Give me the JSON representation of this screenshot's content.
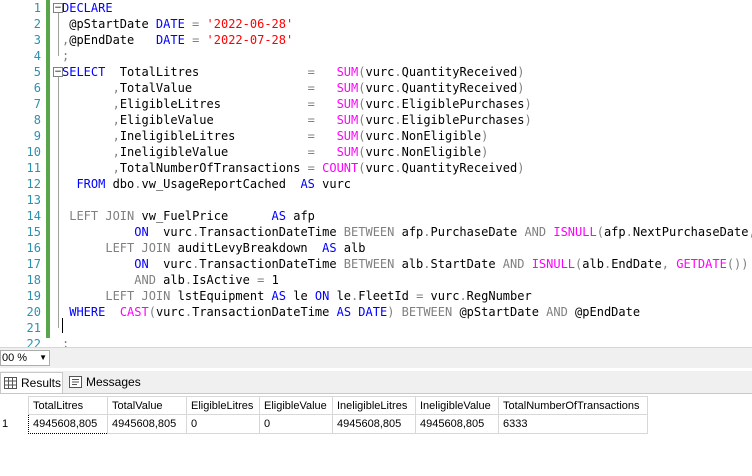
{
  "editor": {
    "lines": [
      {
        "n": "1",
        "tokens": [
          {
            "t": "DECLARE",
            "c": "kw"
          }
        ]
      },
      {
        "n": "2",
        "tokens": [
          {
            "t": " @pStartDate ",
            "c": "var"
          },
          {
            "t": "DATE",
            "c": "kw"
          },
          {
            "t": " = ",
            "c": "op"
          },
          {
            "t": "'2022-06-28'",
            "c": "str"
          }
        ]
      },
      {
        "n": "3",
        "tokens": [
          {
            "t": ",",
            "c": "op"
          },
          {
            "t": "@pEndDate   ",
            "c": "var"
          },
          {
            "t": "DATE",
            "c": "kw"
          },
          {
            "t": " = ",
            "c": "op"
          },
          {
            "t": "'2022-07-28'",
            "c": "str"
          }
        ]
      },
      {
        "n": "4",
        "tokens": [
          {
            "t": ";",
            "c": "op"
          }
        ]
      },
      {
        "n": "5",
        "tokens": [
          {
            "t": "SELECT",
            "c": "kw"
          },
          {
            "t": "  TotalLitres               ",
            "c": "var"
          },
          {
            "t": "=",
            "c": "op"
          },
          {
            "t": "   ",
            "c": "var"
          },
          {
            "t": "SUM",
            "c": "fn"
          },
          {
            "t": "(",
            "c": "op"
          },
          {
            "t": "vurc",
            "c": "var"
          },
          {
            "t": ".",
            "c": "op"
          },
          {
            "t": "QuantityReceived",
            "c": "var"
          },
          {
            "t": ")",
            "c": "op"
          }
        ]
      },
      {
        "n": "6",
        "tokens": [
          {
            "t": "       ",
            "c": "var"
          },
          {
            "t": ",",
            "c": "op"
          },
          {
            "t": "TotalValue                ",
            "c": "var"
          },
          {
            "t": "=",
            "c": "op"
          },
          {
            "t": "   ",
            "c": "var"
          },
          {
            "t": "SUM",
            "c": "fn"
          },
          {
            "t": "(",
            "c": "op"
          },
          {
            "t": "vurc",
            "c": "var"
          },
          {
            "t": ".",
            "c": "op"
          },
          {
            "t": "QuantityReceived",
            "c": "var"
          },
          {
            "t": ")",
            "c": "op"
          }
        ]
      },
      {
        "n": "7",
        "tokens": [
          {
            "t": "       ",
            "c": "var"
          },
          {
            "t": ",",
            "c": "op"
          },
          {
            "t": "EligibleLitres            ",
            "c": "var"
          },
          {
            "t": "=",
            "c": "op"
          },
          {
            "t": "   ",
            "c": "var"
          },
          {
            "t": "SUM",
            "c": "fn"
          },
          {
            "t": "(",
            "c": "op"
          },
          {
            "t": "vurc",
            "c": "var"
          },
          {
            "t": ".",
            "c": "op"
          },
          {
            "t": "EligiblePurchases",
            "c": "var"
          },
          {
            "t": ")",
            "c": "op"
          }
        ]
      },
      {
        "n": "8",
        "tokens": [
          {
            "t": "       ",
            "c": "var"
          },
          {
            "t": ",",
            "c": "op"
          },
          {
            "t": "EligibleValue             ",
            "c": "var"
          },
          {
            "t": "=",
            "c": "op"
          },
          {
            "t": "   ",
            "c": "var"
          },
          {
            "t": "SUM",
            "c": "fn"
          },
          {
            "t": "(",
            "c": "op"
          },
          {
            "t": "vurc",
            "c": "var"
          },
          {
            "t": ".",
            "c": "op"
          },
          {
            "t": "EligiblePurchases",
            "c": "var"
          },
          {
            "t": ")",
            "c": "op"
          }
        ]
      },
      {
        "n": "9",
        "tokens": [
          {
            "t": "       ",
            "c": "var"
          },
          {
            "t": ",",
            "c": "op"
          },
          {
            "t": "IneligibleLitres          ",
            "c": "var"
          },
          {
            "t": "=",
            "c": "op"
          },
          {
            "t": "   ",
            "c": "var"
          },
          {
            "t": "SUM",
            "c": "fn"
          },
          {
            "t": "(",
            "c": "op"
          },
          {
            "t": "vurc",
            "c": "var"
          },
          {
            "t": ".",
            "c": "op"
          },
          {
            "t": "NonEligible",
            "c": "var"
          },
          {
            "t": ")",
            "c": "op"
          }
        ]
      },
      {
        "n": "10",
        "tokens": [
          {
            "t": "       ",
            "c": "var"
          },
          {
            "t": ",",
            "c": "op"
          },
          {
            "t": "IneligibleValue           ",
            "c": "var"
          },
          {
            "t": "=",
            "c": "op"
          },
          {
            "t": "   ",
            "c": "var"
          },
          {
            "t": "SUM",
            "c": "fn"
          },
          {
            "t": "(",
            "c": "op"
          },
          {
            "t": "vurc",
            "c": "var"
          },
          {
            "t": ".",
            "c": "op"
          },
          {
            "t": "NonEligible",
            "c": "var"
          },
          {
            "t": ")",
            "c": "op"
          }
        ]
      },
      {
        "n": "11",
        "tokens": [
          {
            "t": "       ",
            "c": "var"
          },
          {
            "t": ",",
            "c": "op"
          },
          {
            "t": "TotalNumberOfTransactions ",
            "c": "var"
          },
          {
            "t": "=",
            "c": "op"
          },
          {
            "t": " ",
            "c": "var"
          },
          {
            "t": "COUNT",
            "c": "fn"
          },
          {
            "t": "(",
            "c": "op"
          },
          {
            "t": "vurc",
            "c": "var"
          },
          {
            "t": ".",
            "c": "op"
          },
          {
            "t": "QuantityReceived",
            "c": "var"
          },
          {
            "t": ")",
            "c": "op"
          }
        ]
      },
      {
        "n": "12",
        "tokens": [
          {
            "t": "  ",
            "c": "var"
          },
          {
            "t": "FROM",
            "c": "kw"
          },
          {
            "t": " dbo",
            "c": "var"
          },
          {
            "t": ".",
            "c": "op"
          },
          {
            "t": "vw_UsageReportCached  ",
            "c": "var"
          },
          {
            "t": "AS",
            "c": "kw"
          },
          {
            "t": " vurc",
            "c": "var"
          }
        ]
      },
      {
        "n": "13",
        "tokens": []
      },
      {
        "n": "14",
        "tokens": [
          {
            "t": " ",
            "c": "var"
          },
          {
            "t": "LEFT JOIN",
            "c": "op"
          },
          {
            "t": " vw_FuelPrice      ",
            "c": "var"
          },
          {
            "t": "AS",
            "c": "kw"
          },
          {
            "t": " afp",
            "c": "var"
          }
        ]
      },
      {
        "n": "15",
        "tokens": [
          {
            "t": "          ",
            "c": "var"
          },
          {
            "t": "ON",
            "c": "kw"
          },
          {
            "t": "  vurc",
            "c": "var"
          },
          {
            "t": ".",
            "c": "op"
          },
          {
            "t": "TransactionDateTime ",
            "c": "var"
          },
          {
            "t": "BETWEEN",
            "c": "op"
          },
          {
            "t": " afp",
            "c": "var"
          },
          {
            "t": ".",
            "c": "op"
          },
          {
            "t": "PurchaseDate ",
            "c": "var"
          },
          {
            "t": "AND",
            "c": "op"
          },
          {
            "t": " ",
            "c": "var"
          },
          {
            "t": "ISNULL",
            "c": "fn"
          },
          {
            "t": "(",
            "c": "op"
          },
          {
            "t": "afp",
            "c": "var"
          },
          {
            "t": ".",
            "c": "op"
          },
          {
            "t": "NextPurchaseDate",
            "c": "var"
          },
          {
            "t": ",",
            "c": "op"
          }
        ]
      },
      {
        "n": "16",
        "tokens": [
          {
            "t": "      ",
            "c": "var"
          },
          {
            "t": "LEFT JOIN",
            "c": "op"
          },
          {
            "t": " auditLevyBreakdown  ",
            "c": "var"
          },
          {
            "t": "AS",
            "c": "kw"
          },
          {
            "t": " alb",
            "c": "var"
          }
        ]
      },
      {
        "n": "17",
        "tokens": [
          {
            "t": "          ",
            "c": "var"
          },
          {
            "t": "ON",
            "c": "kw"
          },
          {
            "t": "  vurc",
            "c": "var"
          },
          {
            "t": ".",
            "c": "op"
          },
          {
            "t": "TransactionDateTime ",
            "c": "var"
          },
          {
            "t": "BETWEEN",
            "c": "op"
          },
          {
            "t": " alb",
            "c": "var"
          },
          {
            "t": ".",
            "c": "op"
          },
          {
            "t": "StartDate ",
            "c": "var"
          },
          {
            "t": "AND",
            "c": "op"
          },
          {
            "t": " ",
            "c": "var"
          },
          {
            "t": "ISNULL",
            "c": "fn"
          },
          {
            "t": "(",
            "c": "op"
          },
          {
            "t": "alb",
            "c": "var"
          },
          {
            "t": ".",
            "c": "op"
          },
          {
            "t": "EndDate",
            "c": "var"
          },
          {
            "t": ", ",
            "c": "op"
          },
          {
            "t": "GETDATE",
            "c": "fn"
          },
          {
            "t": "())",
            "c": "op"
          }
        ]
      },
      {
        "n": "18",
        "tokens": [
          {
            "t": "          ",
            "c": "var"
          },
          {
            "t": "AND",
            "c": "op"
          },
          {
            "t": " alb",
            "c": "var"
          },
          {
            "t": ".",
            "c": "op"
          },
          {
            "t": "IsActive ",
            "c": "var"
          },
          {
            "t": "=",
            "c": "op"
          },
          {
            "t": " 1",
            "c": "var"
          }
        ]
      },
      {
        "n": "19",
        "tokens": [
          {
            "t": "      ",
            "c": "var"
          },
          {
            "t": "LEFT JOIN",
            "c": "op"
          },
          {
            "t": " lstEquipment ",
            "c": "var"
          },
          {
            "t": "AS",
            "c": "kw"
          },
          {
            "t": " le ",
            "c": "var"
          },
          {
            "t": "ON",
            "c": "kw"
          },
          {
            "t": " le",
            "c": "var"
          },
          {
            "t": ".",
            "c": "op"
          },
          {
            "t": "FleetId ",
            "c": "var"
          },
          {
            "t": "=",
            "c": "op"
          },
          {
            "t": " vurc",
            "c": "var"
          },
          {
            "t": ".",
            "c": "op"
          },
          {
            "t": "RegNumber",
            "c": "var"
          }
        ]
      },
      {
        "n": "20",
        "tokens": [
          {
            "t": " ",
            "c": "var"
          },
          {
            "t": "WHERE",
            "c": "kw"
          },
          {
            "t": "  ",
            "c": "var"
          },
          {
            "t": "CAST",
            "c": "fn"
          },
          {
            "t": "(",
            "c": "op"
          },
          {
            "t": "vurc",
            "c": "var"
          },
          {
            "t": ".",
            "c": "op"
          },
          {
            "t": "TransactionDateTime ",
            "c": "var"
          },
          {
            "t": "AS",
            "c": "kw"
          },
          {
            "t": " ",
            "c": "var"
          },
          {
            "t": "DATE",
            "c": "kw"
          },
          {
            "t": ") ",
            "c": "op"
          },
          {
            "t": "BETWEEN",
            "c": "op"
          },
          {
            "t": " @pStartDate ",
            "c": "var"
          },
          {
            "t": "AND",
            "c": "op"
          },
          {
            "t": " @pEndDate",
            "c": "var"
          }
        ]
      },
      {
        "n": "21",
        "tokens": []
      },
      {
        "n": "22",
        "tokens": [
          {
            "t": ";",
            "c": "op"
          }
        ]
      }
    ]
  },
  "statusbar": {
    "zoom": "00 %"
  },
  "tabs": [
    {
      "label": "Results",
      "icon": "grid-icon",
      "active": true
    },
    {
      "label": "Messages",
      "icon": "messages-icon",
      "active": false
    }
  ],
  "results": {
    "columns": [
      "TotalLitres",
      "TotalValue",
      "EligibleLitres",
      "EligibleValue",
      "IneligibleLitres",
      "IneligibleValue",
      "TotalNumberOfTransactions"
    ],
    "rows": [
      {
        "num": "1",
        "cells": [
          "4945608,805",
          "4945608,805",
          "0",
          "0",
          "4945608,805",
          "4945608,805",
          "6333"
        ]
      }
    ]
  },
  "colors": {
    "keyword": "#0000ff",
    "string": "#ff0000",
    "function": "#ff00ff",
    "operator": "#808080",
    "line_number": "#2b91af",
    "change_bar": "#57a64a"
  }
}
